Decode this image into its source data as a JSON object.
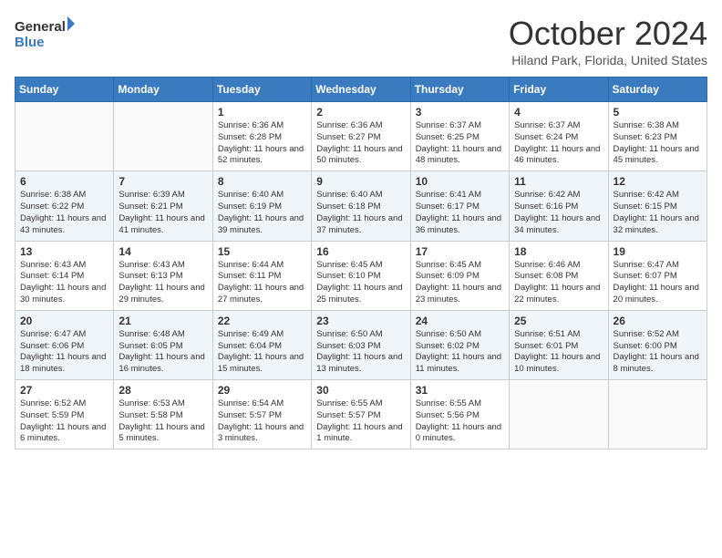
{
  "header": {
    "logo_line1": "General",
    "logo_line2": "Blue",
    "month_title": "October 2024",
    "subtitle": "Hiland Park, Florida, United States"
  },
  "days_of_week": [
    "Sunday",
    "Monday",
    "Tuesday",
    "Wednesday",
    "Thursday",
    "Friday",
    "Saturday"
  ],
  "weeks": [
    [
      {
        "day": "",
        "info": ""
      },
      {
        "day": "",
        "info": ""
      },
      {
        "day": "1",
        "info": "Sunrise: 6:36 AM\nSunset: 6:28 PM\nDaylight: 11 hours and 52 minutes."
      },
      {
        "day": "2",
        "info": "Sunrise: 6:36 AM\nSunset: 6:27 PM\nDaylight: 11 hours and 50 minutes."
      },
      {
        "day": "3",
        "info": "Sunrise: 6:37 AM\nSunset: 6:25 PM\nDaylight: 11 hours and 48 minutes."
      },
      {
        "day": "4",
        "info": "Sunrise: 6:37 AM\nSunset: 6:24 PM\nDaylight: 11 hours and 46 minutes."
      },
      {
        "day": "5",
        "info": "Sunrise: 6:38 AM\nSunset: 6:23 PM\nDaylight: 11 hours and 45 minutes."
      }
    ],
    [
      {
        "day": "6",
        "info": "Sunrise: 6:38 AM\nSunset: 6:22 PM\nDaylight: 11 hours and 43 minutes."
      },
      {
        "day": "7",
        "info": "Sunrise: 6:39 AM\nSunset: 6:21 PM\nDaylight: 11 hours and 41 minutes."
      },
      {
        "day": "8",
        "info": "Sunrise: 6:40 AM\nSunset: 6:19 PM\nDaylight: 11 hours and 39 minutes."
      },
      {
        "day": "9",
        "info": "Sunrise: 6:40 AM\nSunset: 6:18 PM\nDaylight: 11 hours and 37 minutes."
      },
      {
        "day": "10",
        "info": "Sunrise: 6:41 AM\nSunset: 6:17 PM\nDaylight: 11 hours and 36 minutes."
      },
      {
        "day": "11",
        "info": "Sunrise: 6:42 AM\nSunset: 6:16 PM\nDaylight: 11 hours and 34 minutes."
      },
      {
        "day": "12",
        "info": "Sunrise: 6:42 AM\nSunset: 6:15 PM\nDaylight: 11 hours and 32 minutes."
      }
    ],
    [
      {
        "day": "13",
        "info": "Sunrise: 6:43 AM\nSunset: 6:14 PM\nDaylight: 11 hours and 30 minutes."
      },
      {
        "day": "14",
        "info": "Sunrise: 6:43 AM\nSunset: 6:13 PM\nDaylight: 11 hours and 29 minutes."
      },
      {
        "day": "15",
        "info": "Sunrise: 6:44 AM\nSunset: 6:11 PM\nDaylight: 11 hours and 27 minutes."
      },
      {
        "day": "16",
        "info": "Sunrise: 6:45 AM\nSunset: 6:10 PM\nDaylight: 11 hours and 25 minutes."
      },
      {
        "day": "17",
        "info": "Sunrise: 6:45 AM\nSunset: 6:09 PM\nDaylight: 11 hours and 23 minutes."
      },
      {
        "day": "18",
        "info": "Sunrise: 6:46 AM\nSunset: 6:08 PM\nDaylight: 11 hours and 22 minutes."
      },
      {
        "day": "19",
        "info": "Sunrise: 6:47 AM\nSunset: 6:07 PM\nDaylight: 11 hours and 20 minutes."
      }
    ],
    [
      {
        "day": "20",
        "info": "Sunrise: 6:47 AM\nSunset: 6:06 PM\nDaylight: 11 hours and 18 minutes."
      },
      {
        "day": "21",
        "info": "Sunrise: 6:48 AM\nSunset: 6:05 PM\nDaylight: 11 hours and 16 minutes."
      },
      {
        "day": "22",
        "info": "Sunrise: 6:49 AM\nSunset: 6:04 PM\nDaylight: 11 hours and 15 minutes."
      },
      {
        "day": "23",
        "info": "Sunrise: 6:50 AM\nSunset: 6:03 PM\nDaylight: 11 hours and 13 minutes."
      },
      {
        "day": "24",
        "info": "Sunrise: 6:50 AM\nSunset: 6:02 PM\nDaylight: 11 hours and 11 minutes."
      },
      {
        "day": "25",
        "info": "Sunrise: 6:51 AM\nSunset: 6:01 PM\nDaylight: 11 hours and 10 minutes."
      },
      {
        "day": "26",
        "info": "Sunrise: 6:52 AM\nSunset: 6:00 PM\nDaylight: 11 hours and 8 minutes."
      }
    ],
    [
      {
        "day": "27",
        "info": "Sunrise: 6:52 AM\nSunset: 5:59 PM\nDaylight: 11 hours and 6 minutes."
      },
      {
        "day": "28",
        "info": "Sunrise: 6:53 AM\nSunset: 5:58 PM\nDaylight: 11 hours and 5 minutes."
      },
      {
        "day": "29",
        "info": "Sunrise: 6:54 AM\nSunset: 5:57 PM\nDaylight: 11 hours and 3 minutes."
      },
      {
        "day": "30",
        "info": "Sunrise: 6:55 AM\nSunset: 5:57 PM\nDaylight: 11 hours and 1 minute."
      },
      {
        "day": "31",
        "info": "Sunrise: 6:55 AM\nSunset: 5:56 PM\nDaylight: 11 hours and 0 minutes."
      },
      {
        "day": "",
        "info": ""
      },
      {
        "day": "",
        "info": ""
      }
    ]
  ]
}
